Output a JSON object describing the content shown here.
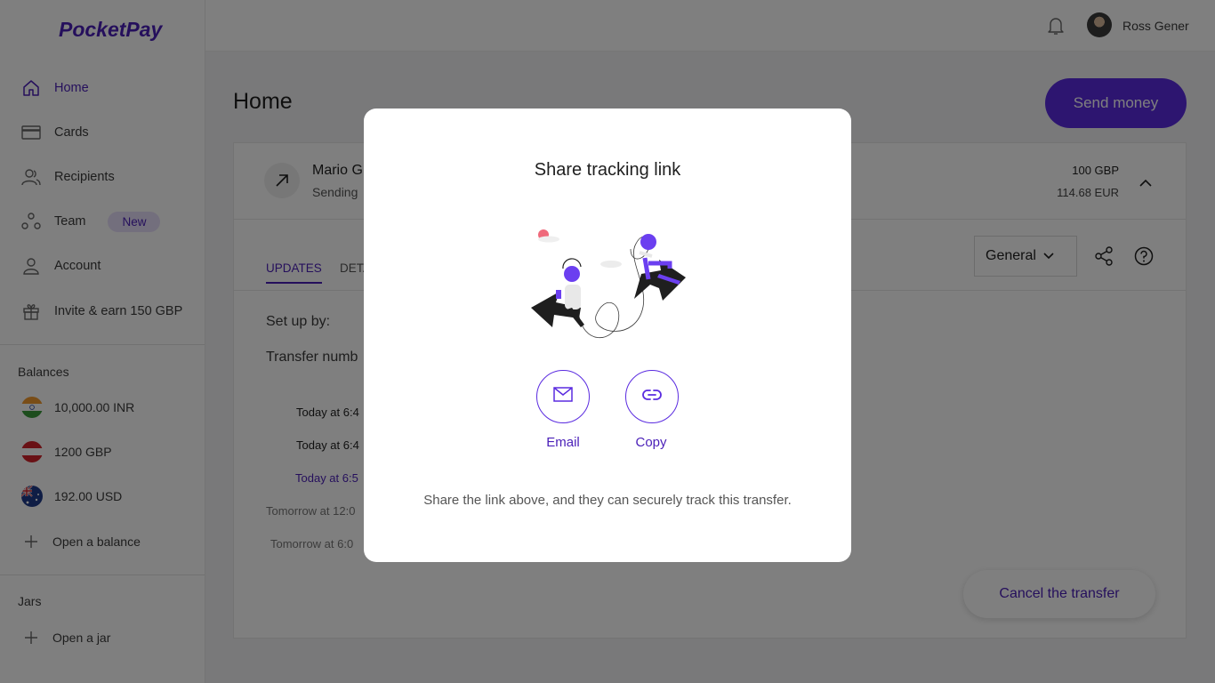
{
  "app": {
    "logo": "PocketPay"
  },
  "sidebar": {
    "nav": [
      {
        "label": "Home",
        "icon": "home-icon"
      },
      {
        "label": "Cards",
        "icon": "card-icon"
      },
      {
        "label": "Recipients",
        "icon": "recipients-icon"
      },
      {
        "label": "Team",
        "icon": "team-icon",
        "badge": "New"
      },
      {
        "label": "Account",
        "icon": "account-icon"
      },
      {
        "label": "Invite & earn 150 GBP",
        "icon": "gift-icon"
      }
    ],
    "balances_label": "Balances",
    "balances": [
      {
        "label": "10,000.00 INR",
        "flag": "india-flag-icon"
      },
      {
        "label": "1200 GBP",
        "flag": "austria-flag-icon"
      },
      {
        "label": "192.00 USD",
        "flag": "australia-flag-icon"
      }
    ],
    "open_balance": "Open a balance",
    "jars_label": "Jars",
    "open_jar": "Open a jar"
  },
  "topbar": {
    "user_name": "Ross Gener"
  },
  "main": {
    "title": "Home",
    "send_money": "Send money",
    "transfer": {
      "recipient": "Mario G",
      "status": "Sending",
      "amount_sent": "100 GBP",
      "amount_received": "114.68 EUR"
    },
    "tabs": [
      "UPDATES",
      "DETA"
    ],
    "dropdown_value": "General",
    "setup_label": "Set up by:",
    "transfer_number_label": "Transfer numb",
    "timeline": [
      "Today at 6:4",
      "Today at 6:4",
      "Today at 6:5",
      "Tomorrow at 12:0",
      "Tomorrow at 6:0"
    ],
    "cancel_transfer": "Cancel the transfer"
  },
  "modal": {
    "title": "Share tracking link",
    "email_label": "Email",
    "copy_label": "Copy",
    "description": "Share the link above, and they can securely track this transfer."
  },
  "colors": {
    "accent": "#5a2be0",
    "brand": "#4a1fb8"
  }
}
